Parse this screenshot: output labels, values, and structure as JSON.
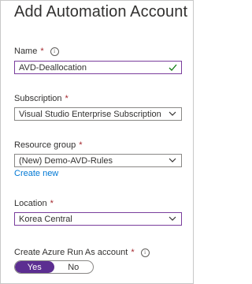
{
  "page": {
    "title": "Add Automation Account"
  },
  "name": {
    "label": "Name",
    "required": "*",
    "value": "AVD-Deallocation"
  },
  "subscription": {
    "label": "Subscription",
    "required": "*",
    "value": "Visual Studio Enterprise Subscription"
  },
  "resource_group": {
    "label": "Resource group",
    "required": "*",
    "value": "(New) Demo-AVD-Rules",
    "create_new": "Create new"
  },
  "location": {
    "label": "Location",
    "required": "*",
    "value": "Korea Central"
  },
  "run_as": {
    "label": "Create Azure Run As account",
    "required": "*",
    "yes": "Yes",
    "no": "No",
    "selected": "Yes"
  },
  "colors": {
    "accent": "#7a3e9d",
    "toggle_on": "#5c2e91",
    "required": "#a4262c",
    "link": "#0078d4",
    "valid": "#107c10"
  },
  "icons": {
    "info": "info-icon",
    "check": "checkmark-icon",
    "dropdown": "chevron-down-icon"
  }
}
